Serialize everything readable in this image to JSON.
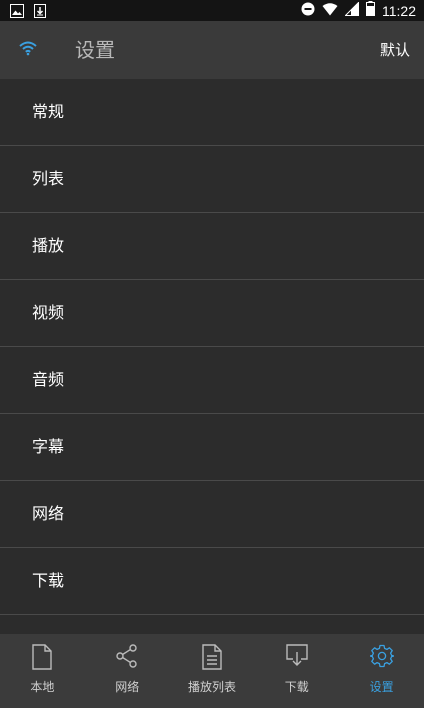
{
  "status_bar": {
    "time": "11:22",
    "icons": [
      "image-icon",
      "download-notification-icon",
      "do-not-disturb-icon",
      "wifi-icon",
      "signal-icon",
      "battery-icon"
    ]
  },
  "header": {
    "title": "设置",
    "action_label": "默认",
    "icon": "wifi-icon",
    "accent_color": "#3aa0e0"
  },
  "settings": {
    "items": [
      {
        "label": "常规"
      },
      {
        "label": "列表"
      },
      {
        "label": "播放"
      },
      {
        "label": "视频"
      },
      {
        "label": "音频"
      },
      {
        "label": "字幕"
      },
      {
        "label": "网络"
      },
      {
        "label": "下载"
      }
    ]
  },
  "bottom_nav": {
    "items": [
      {
        "label": "本地",
        "icon": "file-icon"
      },
      {
        "label": "网络",
        "icon": "share-icon"
      },
      {
        "label": "播放列表",
        "icon": "playlist-icon"
      },
      {
        "label": "下载",
        "icon": "download-icon"
      },
      {
        "label": "设置",
        "icon": "gear-icon",
        "active": true
      }
    ]
  }
}
